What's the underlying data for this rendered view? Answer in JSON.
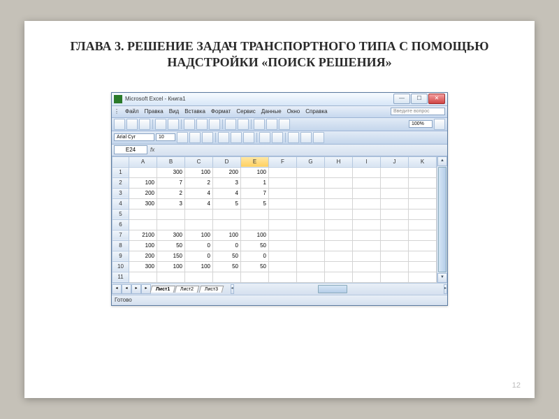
{
  "slide": {
    "title": "ГЛАВА 3. РЕШЕНИЕ ЗАДАЧ ТРАНСПОРТНОГО ТИПА С ПОМОЩЬЮ НАДСТРОЙКИ «ПОИСК РЕШЕНИЯ»",
    "page_number": "12"
  },
  "excel": {
    "title": "Microsoft Excel - Книга1",
    "menu": [
      "Файл",
      "Правка",
      "Вид",
      "Вставка",
      "Формат",
      "Сервис",
      "Данные",
      "Окно",
      "Справка"
    ],
    "help_placeholder": "Введите вопрос",
    "zoom": "100%",
    "font_name": "Arial Cyr",
    "font_size": "10",
    "cell_ref": "E24",
    "fx": "fx",
    "columns": [
      "A",
      "B",
      "C",
      "D",
      "E",
      "F",
      "G",
      "H",
      "I",
      "J",
      "K"
    ],
    "row_count": 11,
    "selected_col": "E",
    "data": {
      "1": {
        "B": "300",
        "C": "100",
        "D": "200",
        "E": "100"
      },
      "2": {
        "A": "100",
        "B": "7",
        "C": "2",
        "D": "3",
        "E": "1"
      },
      "3": {
        "A": "200",
        "B": "2",
        "C": "4",
        "D": "4",
        "E": "7"
      },
      "4": {
        "A": "300",
        "B": "3",
        "C": "4",
        "D": "5",
        "E": "5"
      },
      "7": {
        "A": "2100",
        "B": "300",
        "C": "100",
        "D": "100",
        "E": "100"
      },
      "8": {
        "A": "100",
        "B": "50",
        "C": "0",
        "D": "0",
        "E": "50"
      },
      "9": {
        "A": "200",
        "B": "150",
        "C": "0",
        "D": "50",
        "E": "0"
      },
      "10": {
        "A": "300",
        "B": "100",
        "C": "100",
        "D": "50",
        "E": "50"
      }
    },
    "sheets": [
      "Лист1",
      "Лист2",
      "Лист3"
    ],
    "active_sheet": "Лист1",
    "status": "Готово"
  }
}
